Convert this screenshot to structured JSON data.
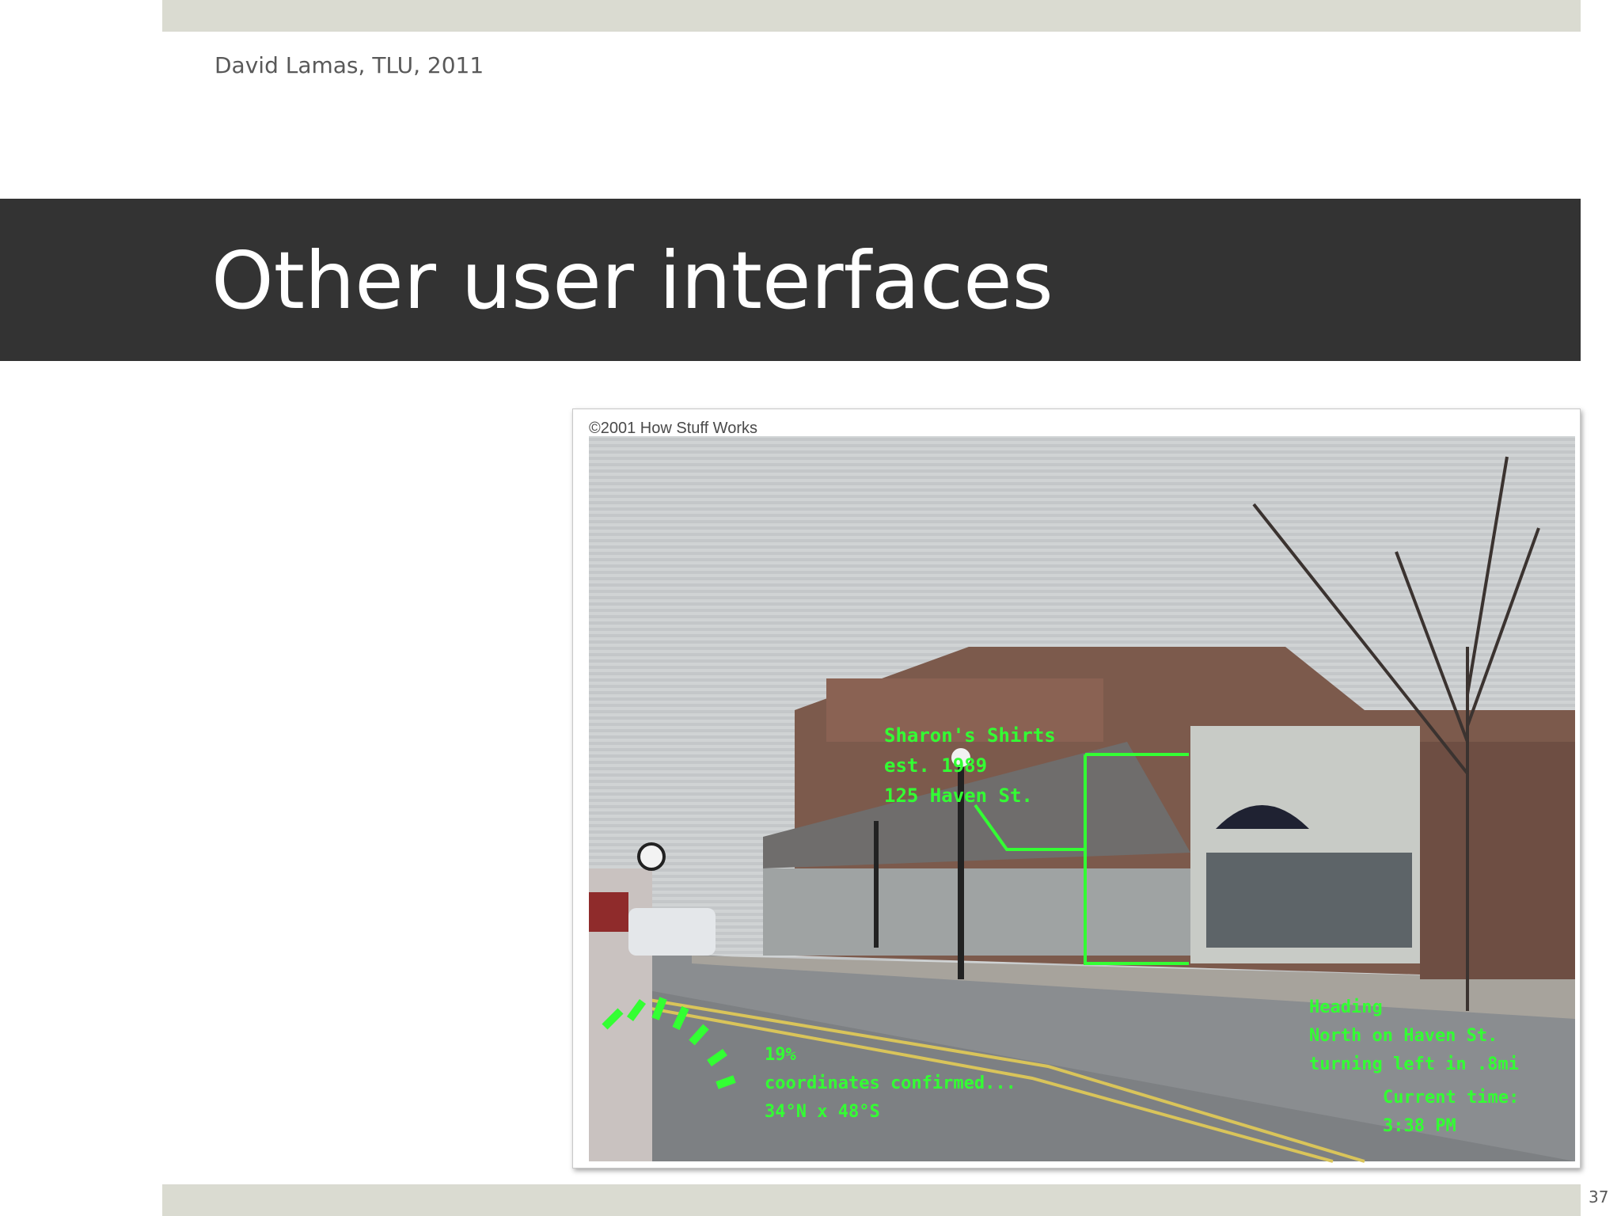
{
  "header": {
    "author_line": "David Lamas, TLU, 2011"
  },
  "slide": {
    "title": "Other user interfaces",
    "page_number": "37"
  },
  "figure": {
    "copyright": "©2001 How Stuff Works",
    "hud_color": "#33ff33",
    "store_label": [
      "Sharon's Shirts",
      "est. 1989",
      "125 Haven St."
    ],
    "heading_label": [
      "Heading",
      "North on Haven St.",
      "turning left in .8mi"
    ],
    "gps_label": [
      "19%",
      "coordinates confirmed...",
      "34°N x 48°S"
    ],
    "time_label": [
      "Current time:",
      "3:38 PM"
    ]
  },
  "colors": {
    "title_bar": "#333333",
    "bands": "#dadbd1",
    "text": "#595959"
  }
}
